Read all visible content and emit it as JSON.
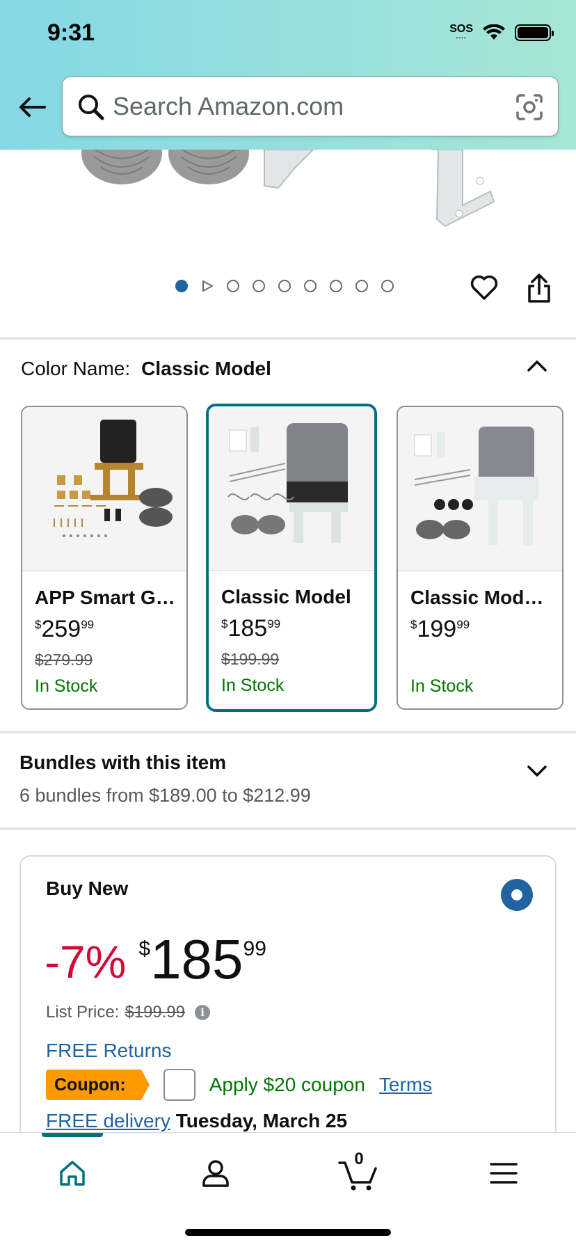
{
  "status_bar": {
    "time": "9:31",
    "sos": "SOS"
  },
  "search": {
    "placeholder": "Search Amazon.com"
  },
  "gallery": {
    "dot_count": 9,
    "active_index": 0
  },
  "color": {
    "label": "Color Name:",
    "value": "Classic Model"
  },
  "swatches": [
    {
      "title": "APP Smart Gate Opener",
      "price_whole": "259",
      "price_frac": "99",
      "price_sym": "$",
      "list_price": "$279.99",
      "stock": "In Stock",
      "selected": false
    },
    {
      "title": "Classic Model",
      "price_whole": "185",
      "price_frac": "99",
      "price_sym": "$",
      "list_price": "$199.99",
      "stock": "In Stock",
      "selected": true
    },
    {
      "title": "Classic Model Pro",
      "price_whole": "199",
      "price_frac": "99",
      "price_sym": "$",
      "list_price": "",
      "stock": "In Stock",
      "selected": false
    }
  ],
  "bundles": {
    "title": "Bundles with this item",
    "subtitle": "6 bundles from $189.00 to $212.99"
  },
  "buy": {
    "title": "Buy New",
    "discount": "-7%",
    "price_sym": "$",
    "price_whole": "185",
    "price_frac": "99",
    "list_label": "List Price:",
    "list_price": "$199.99",
    "returns": "FREE Returns",
    "coupon_badge": "Coupon:",
    "coupon_text": "Apply $20 coupon",
    "coupon_terms": "Terms",
    "delivery_link": "FREE delivery",
    "delivery_date": "Tuesday, March 25"
  },
  "nav": {
    "cart_count": "0"
  },
  "colors": {
    "accent": "#007185",
    "link": "#2162a1",
    "deal": "#cc0c39",
    "stock": "#007600",
    "coupon": "#ff9900"
  }
}
